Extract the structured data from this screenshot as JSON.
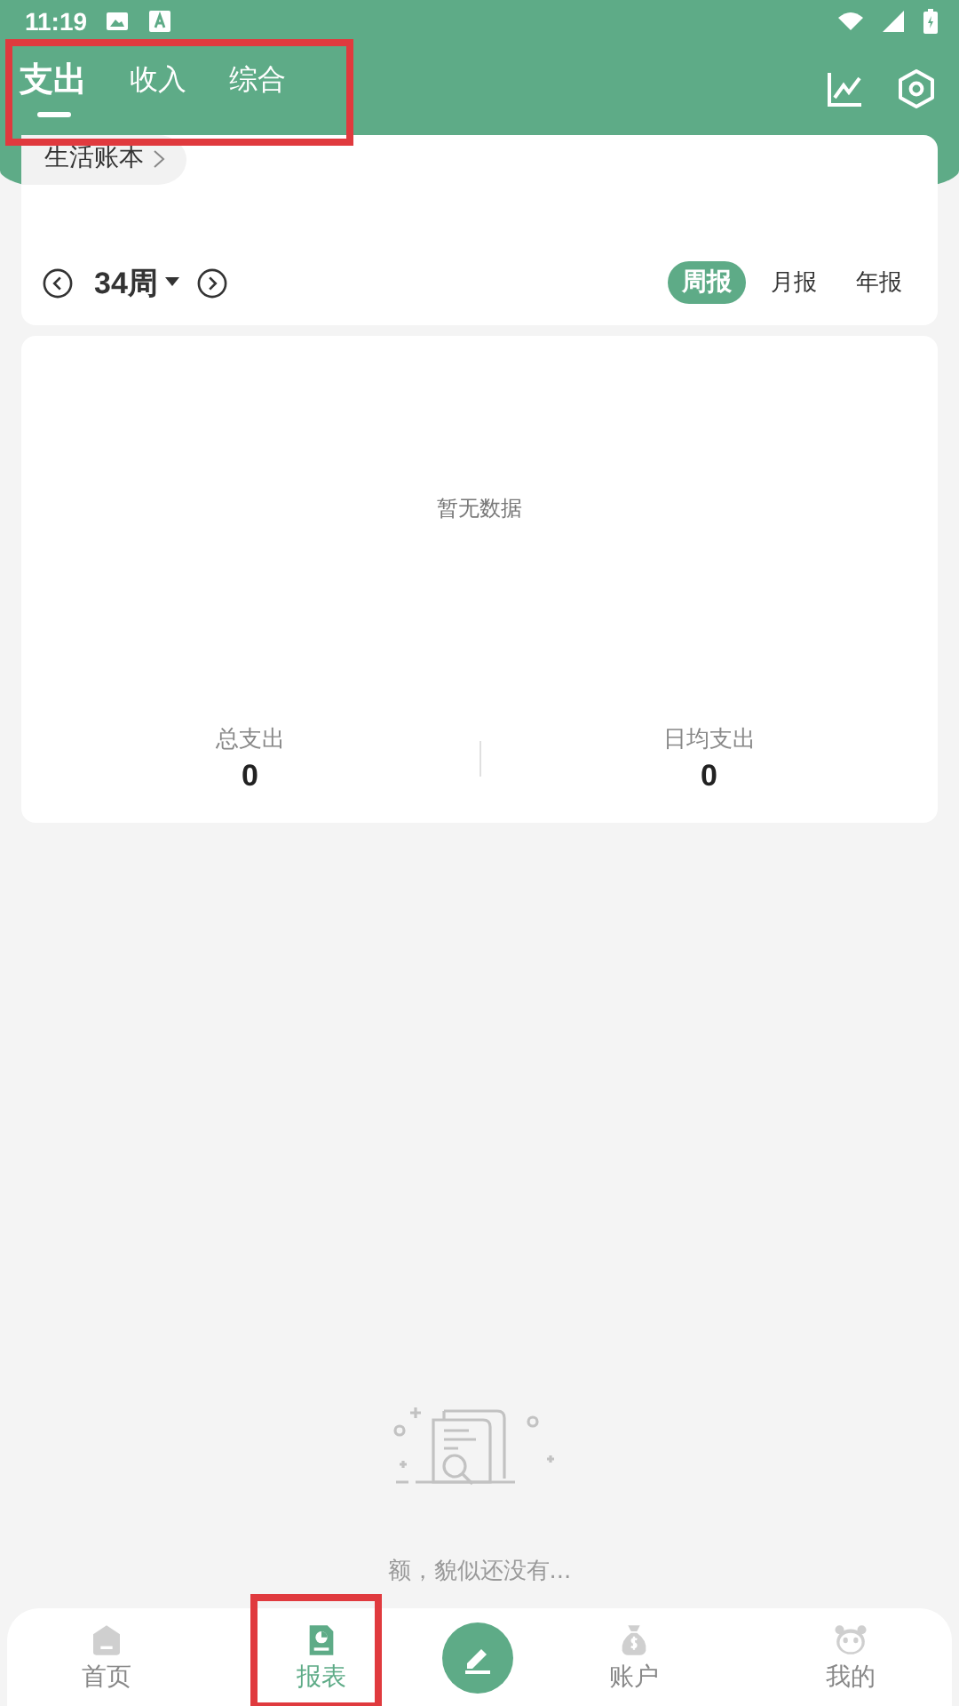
{
  "status_bar": {
    "time": "11:19"
  },
  "tabs": [
    {
      "label": "支出",
      "selected": true
    },
    {
      "label": "收入",
      "selected": false
    },
    {
      "label": "综合",
      "selected": false
    }
  ],
  "book": {
    "label": "生活账本"
  },
  "period": {
    "label": "34周"
  },
  "report_types": [
    {
      "label": "周报",
      "selected": true
    },
    {
      "label": "月报",
      "selected": false
    },
    {
      "label": "年报",
      "selected": false
    }
  ],
  "chart_empty": "暂无数据",
  "stats": [
    {
      "label": "总支出",
      "value": "0"
    },
    {
      "label": "日均支出",
      "value": "0"
    }
  ],
  "empty_state": "额，貌似还没有...",
  "nav": [
    {
      "kind": "tab",
      "label": "首页",
      "selected": false
    },
    {
      "kind": "tab",
      "label": "报表",
      "selected": true
    },
    {
      "kind": "compose"
    },
    {
      "kind": "tab",
      "label": "账户",
      "selected": false
    },
    {
      "kind": "tab",
      "label": "我的",
      "selected": false
    }
  ]
}
